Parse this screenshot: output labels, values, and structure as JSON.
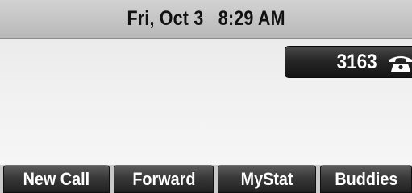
{
  "status_bar": {
    "datetime": "Fri, Oct 3   8:29 AM"
  },
  "line_key": {
    "number": "3163",
    "icon": "phone-handset-icon"
  },
  "softkeys": [
    {
      "label": "New Call"
    },
    {
      "label": "Forward"
    },
    {
      "label": "MyStat"
    },
    {
      "label": "Buddies"
    }
  ],
  "colors": {
    "status_bar_bg": "#c4c4c4",
    "main_bg": "#f1f1f1",
    "key_bg": "#2a2a2a",
    "key_text": "#ffffff"
  }
}
